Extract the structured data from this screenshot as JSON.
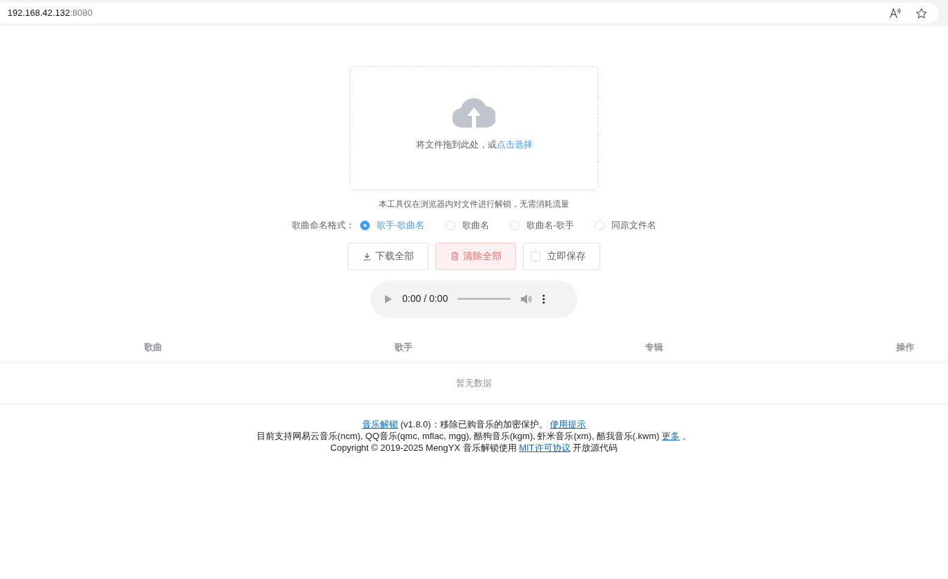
{
  "address_bar": {
    "host": "192.168.42.132",
    "port": ":8080"
  },
  "upload": {
    "prompt": "将文件拖到此处，或",
    "link": "点击选择"
  },
  "notice": "本工具仅在浏览器内对文件进行解锁，无需消耗流量",
  "naming_format": {
    "label": "歌曲命名格式：",
    "options": [
      {
        "label": "歌手-歌曲名",
        "selected": true
      },
      {
        "label": "歌曲名",
        "selected": false
      },
      {
        "label": "歌曲名-歌手",
        "selected": false
      },
      {
        "label": "同原文件名",
        "selected": false
      }
    ]
  },
  "buttons": [
    {
      "kind": "download",
      "label": "下载全部"
    },
    {
      "kind": "clear",
      "label": "清除全部"
    },
    {
      "kind": "checkbox",
      "label": "立即保存",
      "checked": false
    }
  ],
  "audio_player": {
    "time": "0:00 / 0:00"
  },
  "table": {
    "columns": [
      "歌曲",
      "歌手",
      "专辑",
      "操作"
    ],
    "empty_text": "暂无数据"
  },
  "footer": [
    [
      {
        "text": "音乐解锁",
        "link": true
      },
      {
        "text": " (v1.8.0)：移除已购音乐的加密保护。 ",
        "link": false
      },
      {
        "text": "使用提示",
        "link": true
      }
    ],
    [
      {
        "text": "目前支持网易云音乐(ncm), QQ音乐(qmc, mflac, mgg), 酷狗音乐(kgm), 虾米音乐(xm), 酷我音乐(.kwm) ",
        "link": false
      },
      {
        "text": "更多",
        "link": true
      },
      {
        "text": " 。",
        "link": false
      }
    ],
    [
      {
        "text": "Copyright © 2019-2025 MengYX 音乐解锁使用 ",
        "link": false
      },
      {
        "text": "MIT许可协议",
        "link": true
      },
      {
        "text": " 开放源代码",
        "link": false
      }
    ]
  ]
}
